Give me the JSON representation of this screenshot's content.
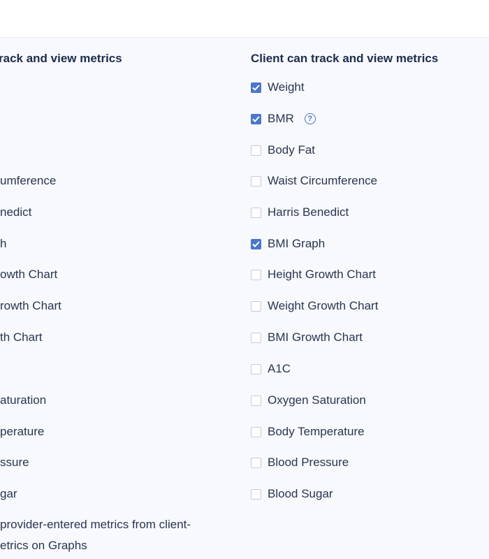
{
  "left_column": {
    "header": "rack and view metrics",
    "items": [
      "umference",
      "nedict",
      "h",
      "owth Chart",
      "rowth Chart",
      "th Chart",
      "aturation",
      "perature",
      "ssure",
      "gar"
    ],
    "footer_lines": [
      "provider-entered metrics from client-",
      "etrics on Graphs"
    ]
  },
  "right_column": {
    "header": "Client can track and view metrics",
    "items": [
      {
        "label": "Weight",
        "checked": true
      },
      {
        "label": "BMR",
        "checked": true
      },
      {
        "label": "Body Fat",
        "checked": false
      },
      {
        "label": "Waist Circumference",
        "checked": false
      },
      {
        "label": "Harris Benedict",
        "checked": false
      },
      {
        "label": "BMI Graph",
        "checked": true
      },
      {
        "label": "Height Growth Chart",
        "checked": false
      },
      {
        "label": "Weight Growth Chart",
        "checked": false
      },
      {
        "label": "BMI Growth Chart",
        "checked": false
      },
      {
        "label": "A1C",
        "checked": false
      },
      {
        "label": "Oxygen Saturation",
        "checked": false
      },
      {
        "label": "Body Temperature",
        "checked": false
      },
      {
        "label": "Blood Pressure",
        "checked": false
      },
      {
        "label": "Blood Sugar",
        "checked": false
      }
    ],
    "bmr_help_glyph": "?"
  },
  "colors": {
    "accent": "#4a77c9",
    "panel_bg": "#f7f9fc",
    "text": "#1f2b4d"
  }
}
